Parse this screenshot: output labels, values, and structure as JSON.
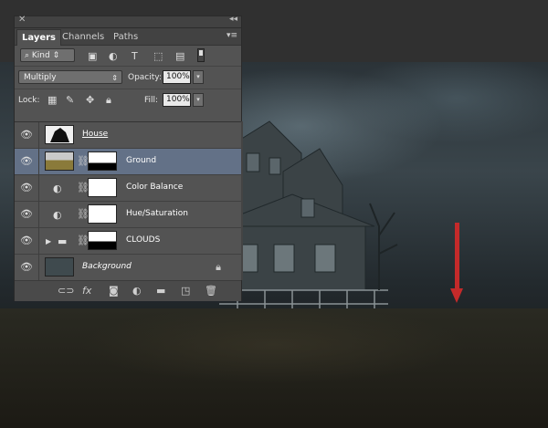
{
  "panel_tabs": [
    "Layers",
    "Channels",
    "Paths"
  ],
  "filter": {
    "kind_label": "Kind"
  },
  "blend": {
    "mode": "Multiply",
    "opacity_label": "Opacity:",
    "opacity_value": "100%"
  },
  "lock": {
    "label": "Lock:",
    "fill_label": "Fill:",
    "fill_value": "100%"
  },
  "layers": [
    {
      "name": "House"
    },
    {
      "name": "Ground"
    },
    {
      "name": "Color Balance"
    },
    {
      "name": "Hue/Saturation"
    },
    {
      "name": "CLOUDS"
    },
    {
      "name": "Background"
    }
  ],
  "bottom_icons": [
    "link-icon",
    "fx-icon",
    "mask-icon",
    "adjustment-icon",
    "folder-icon",
    "new-layer-icon",
    "trash-icon"
  ],
  "colors": {
    "selected_row": "#637187",
    "arrow": "#c42a2a",
    "panel": "#535353"
  }
}
